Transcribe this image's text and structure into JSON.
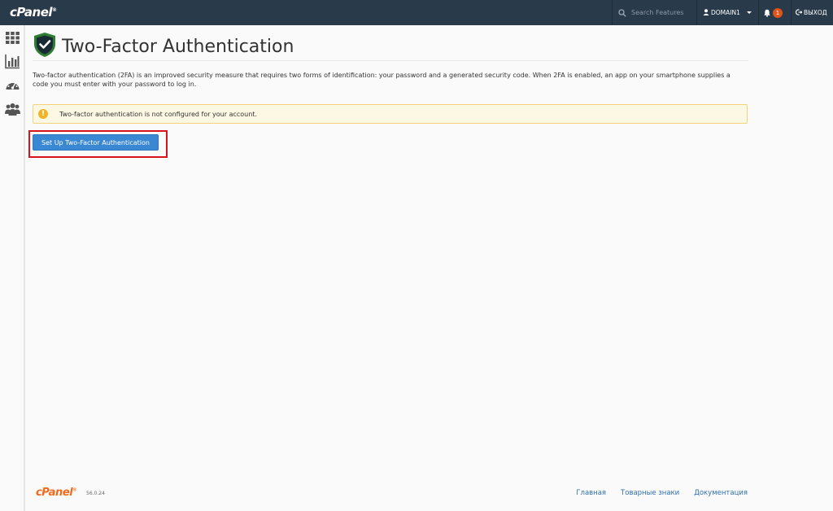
{
  "header": {
    "logo_text": "cPanel",
    "search_placeholder": "Search Features",
    "user_label": "DOMAIN1",
    "notification_count": "1",
    "logout_label": "ВЫХОД"
  },
  "sidebar": {
    "items": [
      {
        "icon": "grid-icon"
      },
      {
        "icon": "bar-chart-icon"
      },
      {
        "icon": "dashboard-gauge-icon"
      },
      {
        "icon": "users-icon"
      }
    ]
  },
  "main": {
    "title": "Two-Factor Authentication",
    "description": "Two-factor authentication (2FA) is an improved security measure that requires two forms of identification: your password and a generated security code. When 2FA is enabled, an app on your smartphone supplies a code you must enter with your password to log in.",
    "alert_text": "Two-factor authentication is not configured for your account.",
    "setup_button_label": "Set Up Two-Factor Authentication"
  },
  "footer": {
    "logo_text": "cPanel",
    "version": "56.0.24",
    "links": [
      "Главная",
      "Товарные знаки",
      "Документация"
    ]
  },
  "colors": {
    "topbar": "#293a4a",
    "primary_button": "#3a87d3",
    "alert_bg": "#fcf8e3",
    "highlight": "#d9131b",
    "badge": "#e0541b",
    "footer_logo": "#f26b1d"
  }
}
